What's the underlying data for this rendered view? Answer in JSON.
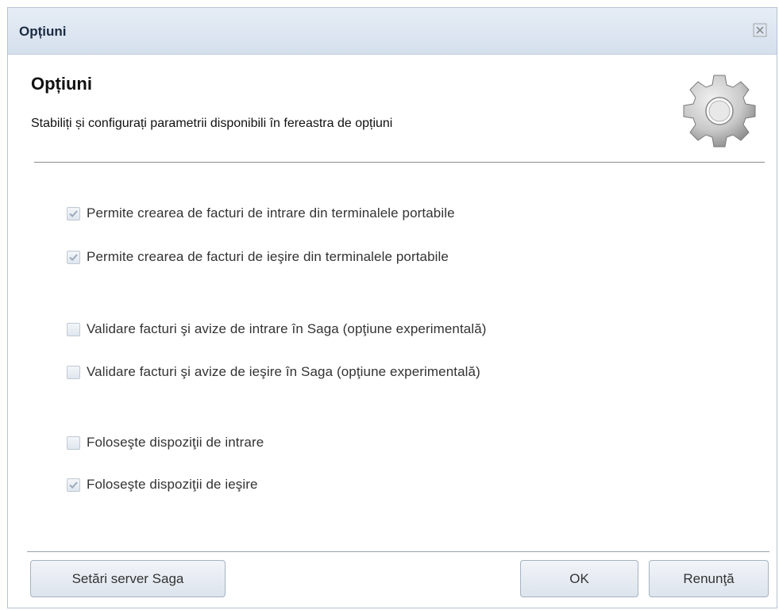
{
  "window": {
    "title": "Opțiuni"
  },
  "header": {
    "title": "Opțiuni",
    "subtitle": "Stabiliți și configurați parametrii disponibili în fereastra de opțiuni"
  },
  "options": [
    {
      "label": "Permite crearea de facturi de intrare din terminalele portabile",
      "checked": true
    },
    {
      "label": "Permite crearea de facturi de ieşire din terminalele portabile",
      "checked": true
    },
    {
      "label": "Validare facturi şi avize de intrare în Saga (opţiune experimentală)",
      "checked": false
    },
    {
      "label": "Validare facturi şi avize de ieşire în Saga (opţiune experimentală)",
      "checked": false
    },
    {
      "label": "Foloseşte dispoziţii de intrare",
      "checked": false
    },
    {
      "label": "Foloseşte dispoziţii de ieşire",
      "checked": true
    }
  ],
  "buttons": {
    "server_settings": "Setări server Saga",
    "ok": "OK",
    "cancel": "Renunţă"
  },
  "icons": {
    "close": "close-icon",
    "gear": "gear-icon",
    "checkmark": "checkmark-icon"
  },
  "colors": {
    "titlebar": "#dbe5f1",
    "checkmark": "#9aa9bb"
  }
}
